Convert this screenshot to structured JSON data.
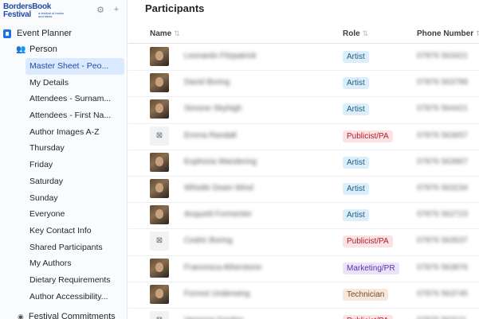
{
  "brand": {
    "line1": "BordersBook",
    "line2": "Festival",
    "tagline": "a festival of books and ideas"
  },
  "sidebar": {
    "top_icons": [
      "gear-icon",
      "plus-icon"
    ],
    "base_name": "Event Planner",
    "table_name": "Person",
    "views": [
      "Master Sheet - Peo...",
      "My Details",
      "Attendees - Surnam...",
      "Attendees - First Na...",
      "Author Images A-Z",
      "Thursday",
      "Friday",
      "Saturday",
      "Sunday",
      "Everyone",
      "Key Contact Info",
      "Shared Participants",
      "My Authors",
      "Dietary Requirements",
      "Author Accessibility..."
    ],
    "active_view": 0,
    "next_table": "Festival Commitments"
  },
  "main": {
    "title": "Participants",
    "columns": {
      "name": "Name",
      "role": "Role",
      "phone": "Phone Number"
    },
    "role_colors": {
      "Artist": {
        "bg": "#dbeefa",
        "fg": "#1b5e85"
      },
      "Publicist/PA": {
        "bg": "#fde2e4",
        "fg": "#a8202f"
      },
      "Marketing/PR": {
        "bg": "#ece3fb",
        "fg": "#5b32a6"
      },
      "Technician": {
        "bg": "#f6e8dc",
        "fg": "#7a4b26"
      }
    },
    "rows": [
      {
        "name": "Leonardo Fitzpatrick",
        "role": "Artist",
        "phone": "07876 563421",
        "photo": true
      },
      {
        "name": "David Boring",
        "role": "Artist",
        "phone": "07876 563789",
        "photo": true
      },
      {
        "name": "Simone Skyhigh",
        "role": "Artist",
        "phone": "07876 564421",
        "photo": true
      },
      {
        "name": "Emma Randall",
        "role": "Publicist/PA",
        "phone": "07876 563657",
        "photo": false
      },
      {
        "name": "Euphoria Wandering",
        "role": "Artist",
        "phone": "07876 563967",
        "photo": true
      },
      {
        "name": "Whistle Down Wind",
        "role": "Artist",
        "phone": "07876 563234",
        "photo": true
      },
      {
        "name": "Anquetil Formenter",
        "role": "Artist",
        "phone": "07876 562723",
        "photo": true
      },
      {
        "name": "Cedric Boring",
        "role": "Publicist/PA",
        "phone": "07876 563537",
        "photo": false
      },
      {
        "name": "Francesca Atherstone",
        "role": "Marketing/PR",
        "phone": "07876 563876",
        "photo": true
      },
      {
        "name": "Forrest Underwing",
        "role": "Technician",
        "phone": "07876 563745",
        "photo": true
      },
      {
        "name": "Vanessa Gordon",
        "role": "Publicist/PA",
        "phone": "07876 563111",
        "photo": false
      }
    ]
  }
}
